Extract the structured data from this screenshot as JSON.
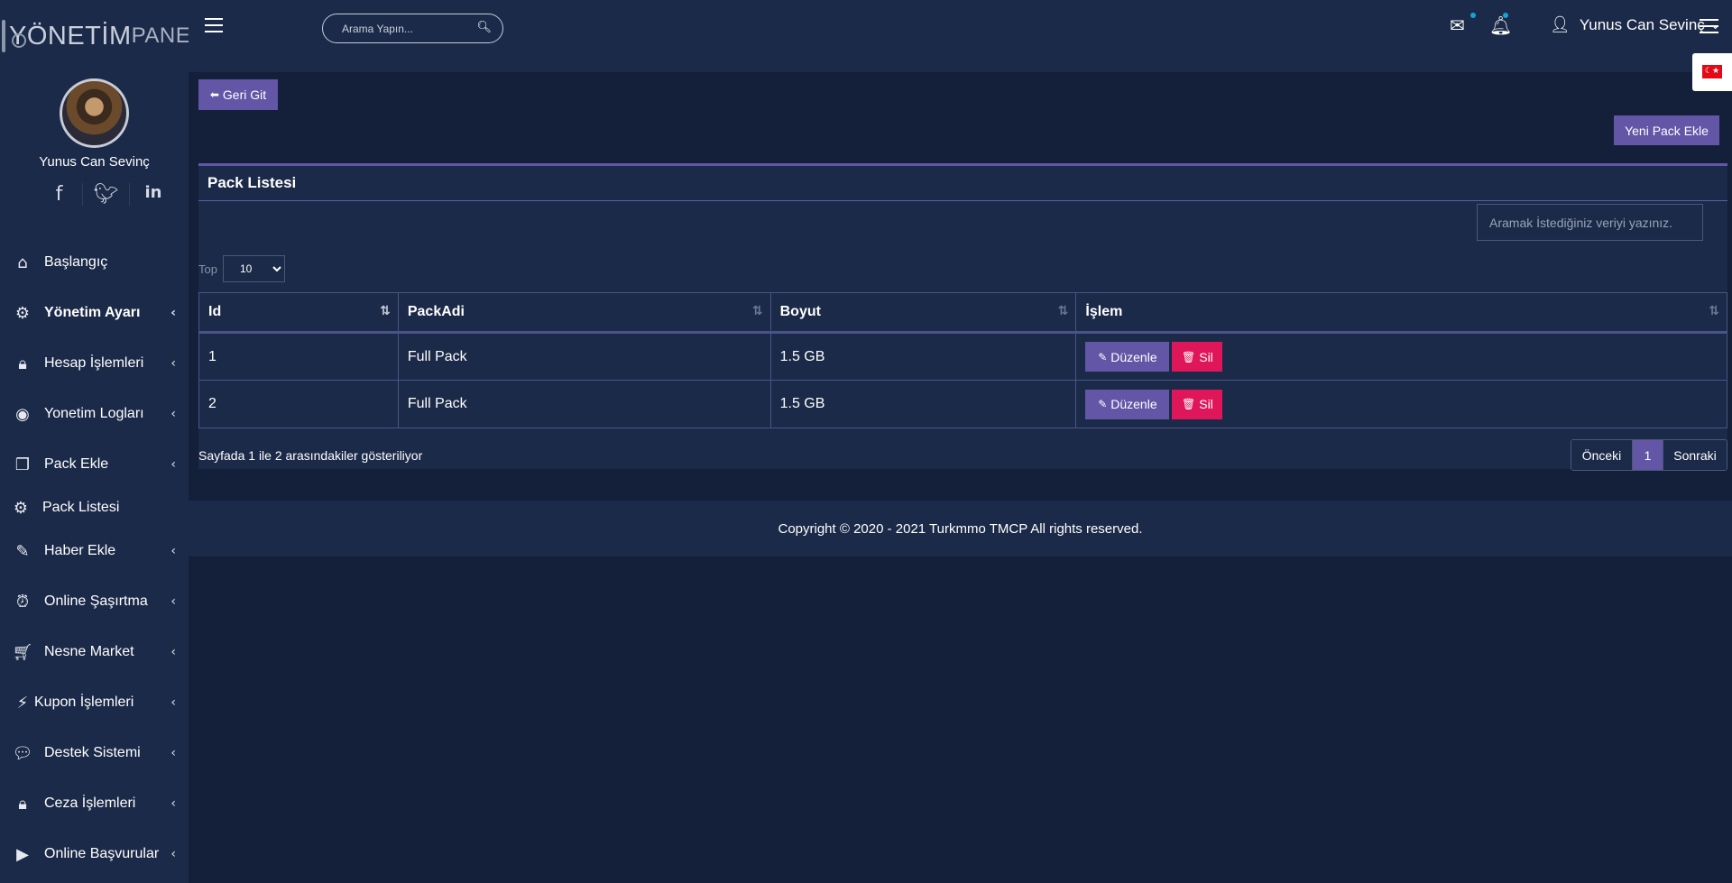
{
  "app": {
    "logo_bold": "YÖNETİM",
    "logo_light": "PANELİ"
  },
  "sidebar": {
    "user_name": "Yunus Can Sevinç",
    "socials": [
      {
        "icon": "facebook-icon",
        "glyph": "f"
      },
      {
        "icon": "twitter-icon",
        "glyph": "t"
      },
      {
        "icon": "linkedin-icon",
        "glyph": "in"
      }
    ],
    "items": [
      {
        "label": "Başlangıç",
        "icon": "home-icon",
        "bold": false,
        "chevron": false
      },
      {
        "label": "Yönetim Ayarı",
        "icon": "gear-icon",
        "bold": true,
        "chevron": true
      },
      {
        "label": "Hesap İşlemleri",
        "icon": "lock-icon",
        "bold": false,
        "chevron": true
      },
      {
        "label": "Yonetim Logları",
        "icon": "eye-icon",
        "bold": false,
        "chevron": true
      },
      {
        "label": "Pack Ekle",
        "icon": "copy-icon",
        "bold": false,
        "chevron": true
      },
      {
        "label": "Pack Listesi",
        "icon": "gears-icon",
        "bold": false,
        "chevron": false
      },
      {
        "label": "Haber Ekle",
        "icon": "edit-icon",
        "bold": false,
        "chevron": true
      },
      {
        "label": "Online Şaşırtma",
        "icon": "alarm-icon",
        "bold": false,
        "chevron": true
      },
      {
        "label": "Nesne Market",
        "icon": "cart-icon",
        "bold": false,
        "chevron": true
      },
      {
        "label": "Kupon İşlemleri",
        "icon": "plug-icon",
        "bold": false,
        "chevron": true
      },
      {
        "label": "Destek Sistemi",
        "icon": "chat-icon",
        "bold": false,
        "chevron": true
      },
      {
        "label": "Ceza İşlemleri",
        "icon": "lock-icon",
        "bold": false,
        "chevron": true
      },
      {
        "label": "Online Başvurular",
        "icon": "youtube-icon",
        "bold": false,
        "chevron": true
      }
    ]
  },
  "header": {
    "search_placeholder": "Arama Yapın...",
    "user_name": "Yunus Can Sevinç"
  },
  "main": {
    "back_label": "Geri Git",
    "new_label": "Yeni Pack Ekle",
    "panel_title": "Pack Listesi",
    "filter_placeholder": "Aramak İstediğiniz veriyi yazınız.",
    "top_label": "Top",
    "page_size": "10",
    "columns": [
      "Id",
      "PackAdi",
      "Boyut",
      "İşlem"
    ],
    "rows": [
      {
        "id": "1",
        "name": "Full Pack",
        "size": "1.5 GB"
      },
      {
        "id": "2",
        "name": "Full Pack",
        "size": "1.5 GB"
      }
    ],
    "edit_label": "Düzenle",
    "delete_label": "Sil",
    "info": "Sayfada 1 ile 2 arasındakiler gösteriliyor",
    "pager": {
      "prev": "Önceki",
      "current": "1",
      "next": "Sonraki"
    }
  },
  "footer": {
    "text": "Copyright © 2020 - 2021 Turkmmo TMCP All rights reserved."
  },
  "colors": {
    "background": "#141f3a",
    "panel": "#1b2a48",
    "accent": "#6356a6",
    "danger": "#e0165a",
    "notification_dot": "#17a2d8"
  }
}
